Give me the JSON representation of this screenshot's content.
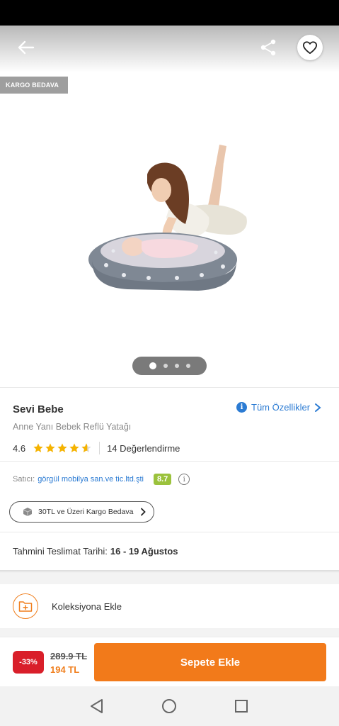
{
  "badge": {
    "kargo": "KARGO BEDAVA"
  },
  "carousel": {
    "pages": 4,
    "active": 1
  },
  "product": {
    "brand": "Sevi Bebe",
    "name": "Anne Yanı Bebek Reflü Yatağı",
    "rating": "4.6",
    "rating_value": 4.6,
    "reviews": "14 Değerlendirme",
    "all_specs": "Tüm Özellikler"
  },
  "seller": {
    "label": "Satıcı:",
    "name": "görgül mobilya san.ve tic.ltd.şti",
    "score": "8.7"
  },
  "shipping": {
    "chip": "30TL ve Üzeri Kargo Bedava"
  },
  "delivery": {
    "label": "Tahmini Teslimat Tarihi:",
    "dates": "16 - 19 Ağustos"
  },
  "collection": {
    "label": "Koleksiyona Ekle"
  },
  "price": {
    "discount": "-33%",
    "old": "289.9 TL",
    "new": "194 TL"
  },
  "cart": {
    "label": "Sepete Ekle"
  },
  "colors": {
    "accent": "#f27a1a",
    "link": "#2b7bd3",
    "discount": "#d91f2a",
    "score": "#9bc23c"
  },
  "icons": [
    "back-arrow-icon",
    "share-icon",
    "heart-icon",
    "info-icon",
    "star-icon",
    "box-icon",
    "chevron-right-icon",
    "folder-plus-icon"
  ]
}
